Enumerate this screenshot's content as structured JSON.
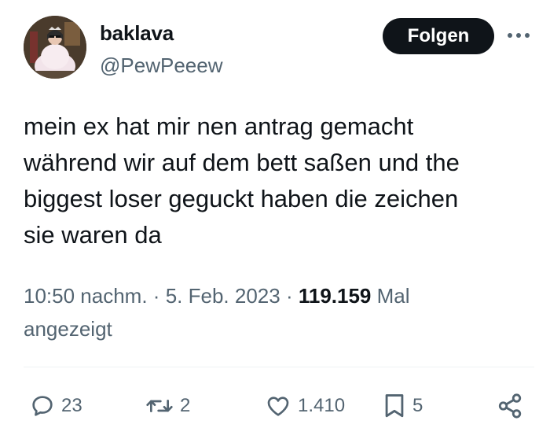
{
  "user": {
    "display_name": "baklava",
    "handle": "@PewPeeew",
    "avatar_icon": "profile-photo"
  },
  "header": {
    "follow_label": "Folgen",
    "more_icon": "more-dots-icon"
  },
  "tweet": {
    "text": "mein ex hat mir nen antrag gemacht\nwährend wir auf dem bett saßen und the\nbiggest loser geguckt haben die zeichen\nsie waren da"
  },
  "meta": {
    "time": "10:50 nachm.",
    "separator": "·",
    "date": "5. Feb. 2023",
    "views_count": "119.159",
    "views_label_1": "Mal",
    "views_label_2": "angezeigt"
  },
  "actions": {
    "replies": "23",
    "retweets": "2",
    "likes": "1.410",
    "bookmarks": "5"
  },
  "colors": {
    "text_primary": "#0f1419",
    "text_secondary": "#536471",
    "button_bg": "#0f1419",
    "divider": "#eff3f4"
  }
}
